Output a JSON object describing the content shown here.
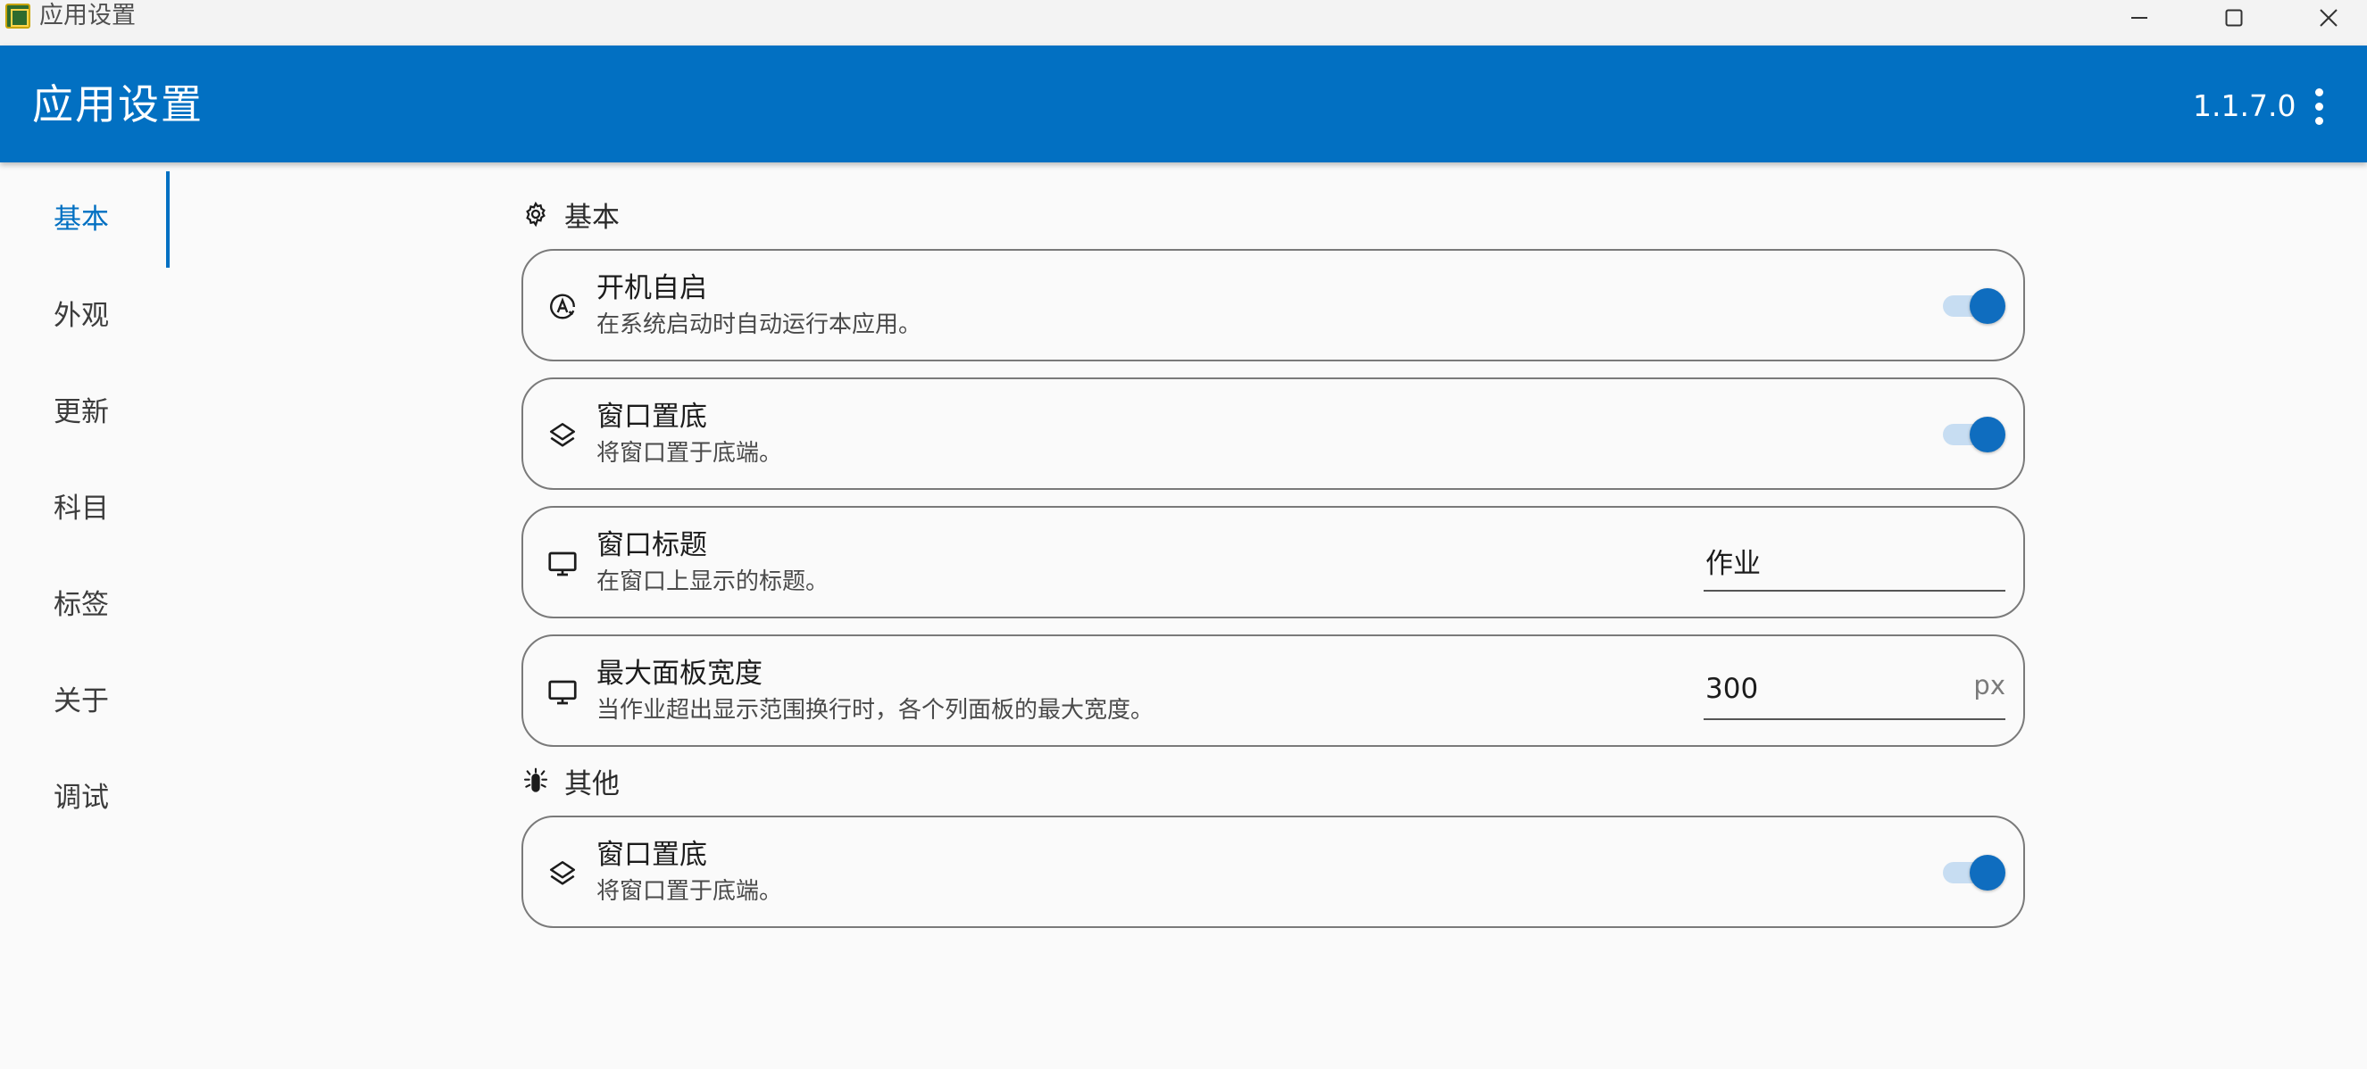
{
  "window": {
    "title": "应用设置",
    "buttons": [
      "minimize",
      "maximize",
      "close"
    ]
  },
  "appbar": {
    "title": "应用设置",
    "version": "1.1.7.0",
    "menu_icon": "more-vert-icon",
    "color": "#0270c2"
  },
  "sidebar": {
    "items": [
      {
        "label": "基本",
        "active": true
      },
      {
        "label": "外观",
        "active": false
      },
      {
        "label": "更新",
        "active": false
      },
      {
        "label": "科目",
        "active": false
      },
      {
        "label": "标签",
        "active": false
      },
      {
        "label": "关于",
        "active": false
      },
      {
        "label": "调试",
        "active": false
      }
    ]
  },
  "sections": [
    {
      "header": "基本",
      "icon": "gear-icon",
      "cards": [
        {
          "title": "开机自启",
          "subtitle": "在系统启动时自动运行本应用。",
          "icon": "autostart-icon",
          "control": "switch",
          "on": true
        },
        {
          "title": "窗口置底",
          "subtitle": "将窗口置于底端。",
          "icon": "layers-icon",
          "control": "switch",
          "on": true
        },
        {
          "title": "窗口标题",
          "subtitle": "在窗口上显示的标题。",
          "icon": "monitor-icon",
          "control": "text",
          "value": "作业"
        },
        {
          "title": "最大面板宽度",
          "subtitle": "当作业超出显示范围换行时，各个列面板的最大宽度。",
          "icon": "monitor-icon",
          "control": "number",
          "value": "300",
          "suffix": "px"
        }
      ]
    },
    {
      "header": "其他",
      "icon": "bug-icon",
      "cards": [
        {
          "title": "窗口置底",
          "subtitle": "将窗口置于底端。",
          "icon": "layers-icon",
          "control": "switch",
          "on": true
        }
      ]
    }
  ]
}
